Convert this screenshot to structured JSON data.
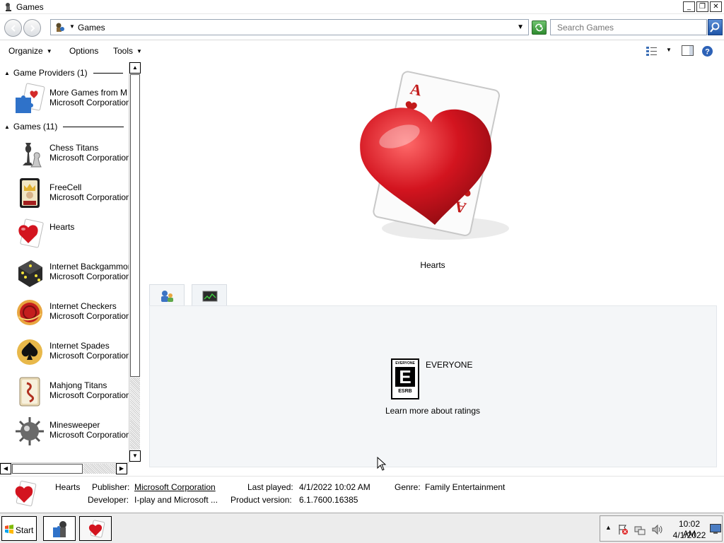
{
  "window": {
    "title": "Games",
    "controls": {
      "minimize": "_",
      "restore": "❐",
      "close": "✕"
    }
  },
  "address_bar": {
    "path_segment": "Games",
    "search_placeholder": "Search Games"
  },
  "command_bar": {
    "organize": "Organize",
    "options": "Options",
    "tools": "Tools"
  },
  "left_pane": {
    "providers_header": "Game Providers (1)",
    "providers": [
      {
        "name": "More Games from M",
        "publisher": "Microsoft Corporation",
        "icon": "puzzle-card-icon"
      }
    ],
    "games_header": "Games (11)",
    "games": [
      {
        "name": "Chess Titans",
        "publisher": "Microsoft Corporation",
        "icon": "chess-icon"
      },
      {
        "name": "FreeCell",
        "publisher": "Microsoft Corporation",
        "icon": "king-card-icon"
      },
      {
        "name": "Hearts",
        "publisher": "",
        "icon": "hearts-icon"
      },
      {
        "name": "Internet Backgammon",
        "publisher": "Microsoft Corporation",
        "icon": "dice-icon"
      },
      {
        "name": "Internet Checkers",
        "publisher": "Microsoft Corporation",
        "icon": "checkers-icon"
      },
      {
        "name": "Internet Spades",
        "publisher": "Microsoft Corporation",
        "icon": "spades-icon"
      },
      {
        "name": "Mahjong Titans",
        "publisher": "Microsoft Corporation",
        "icon": "mahjong-icon"
      },
      {
        "name": "Minesweeper",
        "publisher": "Microsoft Corporation",
        "icon": "mine-icon"
      }
    ]
  },
  "preview": {
    "game_title": "Hearts",
    "rating": {
      "badge_top": "EVERYONE",
      "badge_letter": "E",
      "badge_bottom": "ESRB",
      "label": "EVERYONE",
      "link": "Learn more about ratings"
    }
  },
  "details": {
    "name": "Hearts",
    "publisher_label": "Publisher:",
    "publisher": "Microsoft Corporation",
    "last_played_label": "Last played:",
    "last_played": "4/1/2022 10:02 AM",
    "genre_label": "Genre:",
    "genre": "Family Entertainment",
    "developer_label": "Developer:",
    "developer": "I-play and Microsoft ...",
    "version_label": "Product version:",
    "version": "6.1.7600.16385"
  },
  "taskbar": {
    "start_label": "Start",
    "clock_time": "10:02 AM",
    "clock_date": "4/1/2022"
  },
  "colors": {
    "accent": "#1f55a8",
    "heart_red": "#d3141f",
    "tab_panel_bg": "#f4f6f8"
  }
}
